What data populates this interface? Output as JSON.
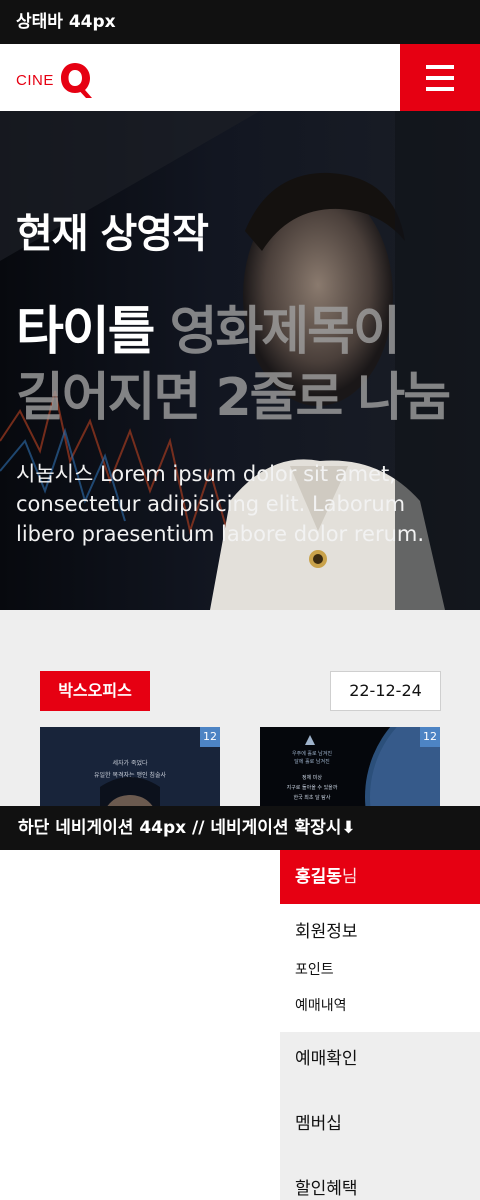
{
  "status_bar": {
    "label": "상태바 44px"
  },
  "header": {
    "logo_text": "CINE",
    "logo_letter": "Q",
    "brand_color": "#e60012",
    "menu_icon": "hamburger-icon"
  },
  "hero": {
    "heading": "현재 상영작",
    "title_lead": "타이틀",
    "title_rest_line1": " 영화제목이",
    "title_line2": "길어지면 2줄로 나눔",
    "synopsis": "시놉시스 Lorem ipsum dolor sit amet, consectetur adipisicing elit. Laborum libero praesentium labore dolor rerum."
  },
  "boxoffice": {
    "badge": "박스오피스",
    "date": "22-12-24",
    "posters": [
      {
        "age": "12",
        "lines": [
          "세자가 죽었다",
          "유일한 목격자는 맹인 침술사"
        ]
      },
      {
        "age": "12",
        "lines": [
          "우주에 홀로 남겨진",
          "달에 홀로 남겨진",
          "정체 미상",
          "지구로 돌아올 수 있을까",
          "한국 최초 달 탐사"
        ]
      }
    ]
  },
  "bottom_nav": {
    "label": "하단 네비게이션 44px // 네비게이션 확장시⬇"
  },
  "drawer": {
    "user_name": "홍길동",
    "user_suffix": "님",
    "member_info": "회원정보",
    "points": "포인트",
    "history": "예매내역",
    "items": [
      "예매확인",
      "멤버십",
      "할인혜택"
    ]
  }
}
